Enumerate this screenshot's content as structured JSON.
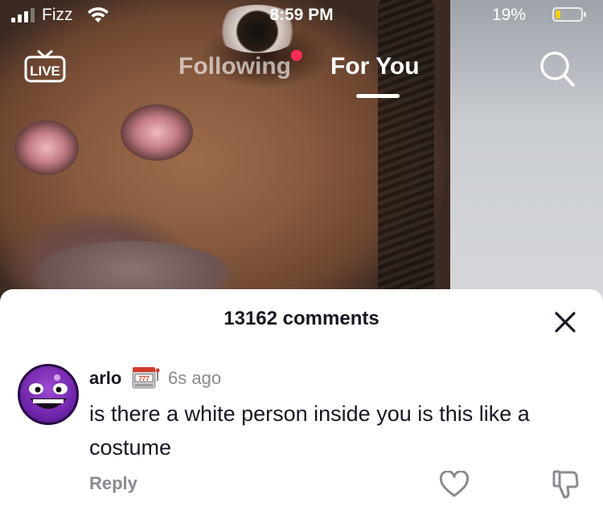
{
  "status_bar": {
    "carrier": "Fizz",
    "time": "8:59 PM",
    "battery_percent": "19%",
    "battery_level": 0.19,
    "battery_color": "#f4d000",
    "signal_bars": 3,
    "signal_icon": "cellular-signal-icon",
    "wifi_icon": "wifi-icon"
  },
  "top_nav": {
    "live_label": "LIVE",
    "live_icon": "tv-live-icon",
    "tabs": [
      {
        "label": "Following",
        "active": false,
        "has_notification_dot": true
      },
      {
        "label": "For You",
        "active": true
      }
    ],
    "notification_dot_color": "#fe2c55",
    "search_icon": "search-icon"
  },
  "comments_panel": {
    "title": "13162 comments",
    "close_icon": "close-icon",
    "comments": [
      {
        "username": "arlo",
        "badge_emoji": "slot-machine-emoji",
        "time_ago": "6s ago",
        "text": "is there a white person inside you is this like a costume",
        "reply_label": "Reply",
        "like_icon": "heart-outline-icon",
        "dislike_icon": "thumbs-down-icon",
        "avatar": "purple-grinning-face-avatar"
      }
    ]
  }
}
